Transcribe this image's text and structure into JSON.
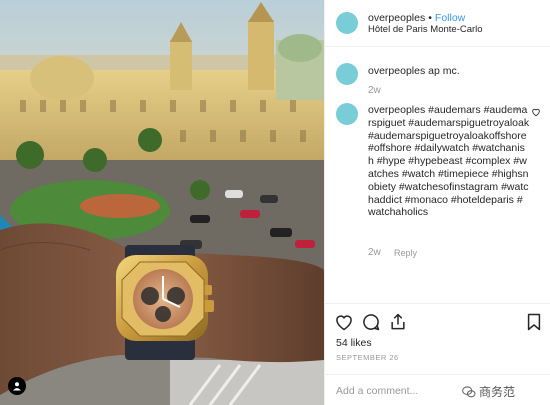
{
  "post": {
    "username": "overpeoples",
    "separator": "•",
    "follow_label": "Follow",
    "location": "Hôtel de Paris Monte-Carlo"
  },
  "comments": [
    {
      "username": "overpeoples",
      "text": "ap mc.",
      "time": ""
    },
    {
      "username": "overpeoples",
      "hashtags": "#audemars #audemarspiguet #audemarspiguetroyaloak #audemarspiguetroyaloakoffshore #offshore #dailywatch #watchanish #hype #hypebeast #complex #watches #watch #timepiece #highsnobiety #watchesofinstagram #watchaddict #monaco #hoteldeparis #watchaholics",
      "time": "2w",
      "reply_label": "Reply",
      "more": "•••"
    }
  ],
  "comment1_time": "2w",
  "likes": "54 likes",
  "date": "SEPTEMBER 26",
  "add_comment_placeholder": "Add a comment...",
  "watermark": "商务范",
  "colors": {
    "avatar": "#79cdd6",
    "link": "#3897f0",
    "muted": "#999999"
  },
  "icons": [
    "heart-icon",
    "comment-icon",
    "share-icon",
    "bookmark-icon",
    "user-tag-icon"
  ]
}
